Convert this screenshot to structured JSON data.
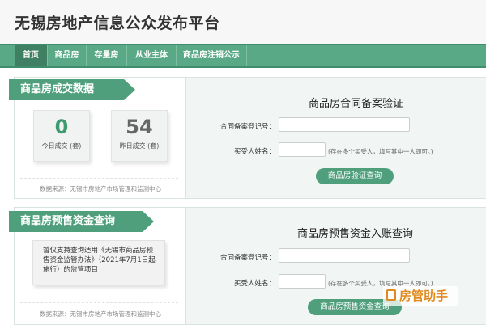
{
  "header": {
    "title": "无锡房地产信息公众发布平台"
  },
  "nav": {
    "items": [
      "首页",
      "商品房",
      "存量房",
      "从业主体",
      "商品房注销公示"
    ]
  },
  "deals": {
    "heading": "商品房成交数据",
    "today_value": "0",
    "today_label": "今日成交 (套)",
    "yesterday_value": "54",
    "yesterday_label": "昨日成交 (套)",
    "source": "数据来源：无锡市房地产市场管理和监测中心"
  },
  "verify": {
    "title": "商品房合同备案验证",
    "contract_label": "合同备案登记号：",
    "buyer_label": "买受人姓名：",
    "hint": "(存在多个买受人，填写其中一人即可。)",
    "button": "商品房验证查询"
  },
  "funds": {
    "heading": "商品房预售资金查询",
    "notice": "暂仅支持查询适用《无锡市商品房预售资金监管办法》（2021年7月1日起施行）的监管项目",
    "source": "数据来源：无锡市房地产市场管理和监测中心"
  },
  "funds_form": {
    "title": "商品房预售资金入账查询",
    "contract_label": "合同备案登记号：",
    "buyer_label": "买受人姓名：",
    "hint": "(存在多个买受人，填写其中一人即可。)",
    "button": "商品房预售资金查询"
  },
  "watermark": {
    "text": "房管助手"
  },
  "colors": {
    "nav": "#5aa986",
    "nav_active": "#3f7f62",
    "accent": "#4f9f7c",
    "today": "#3f9a72",
    "yesterday": "#666666",
    "watermark": "#e08a1e"
  }
}
